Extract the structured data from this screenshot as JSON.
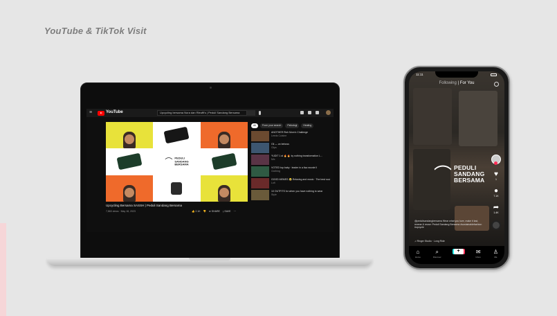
{
  "page": {
    "title": "YouTube & TikTok Visit"
  },
  "youtube": {
    "brand": "YouTube",
    "menu_icon": "hamburger-menu-icon",
    "search_text": "Upcycling bersama Nora dan Rieuffi's | Peduli Sandang Bersama",
    "logo_lines": [
      "PEDULI",
      "SANDANG",
      "BERSAMA"
    ],
    "video_title": "Upcycling Bersama SASSH | Peduli Sandang Bersama",
    "video_meta": "7,863 views · May 18, 2023",
    "actions": [
      "👍 2.1K",
      "👎",
      "➦ SHARE",
      "⤓ SAVE",
      "⋯"
    ],
    "chips": [
      "All",
      "From your search",
      "Psikologi",
      "Healing"
    ],
    "recommended": [
      {
        "title": "ANOTHER Rich Mom's Challenge",
        "channel": "Leeds Cuisine",
        "color": "#6b4a30"
      },
      {
        "title": "Gli — un beboss",
        "channel": "Clips",
        "color": "#3d5670"
      },
      {
        "title": "YUDIT 1 al 🔥 🔥 ky nothing transformation L...",
        "channel": "Mix",
        "color": "#5a3446"
      },
      {
        "title": "VOTED top baby · leader in a lisa rwonle Il",
        "channel": "Clothing",
        "color": "#2f5a43"
      },
      {
        "title": "GOOD MEMES 😂 Relaxing and music · The best soul minute",
        "channel": "Lofi",
        "color": "#6a2a2a"
      },
      {
        "title": "10 OUTFITS for when you have nothing to wear",
        "channel": "Style",
        "color": "#6a5a3a"
      }
    ]
  },
  "tiktok": {
    "status_time": "11:11",
    "tab_following": "Following",
    "tab_foryou": "For You",
    "logo_lines": [
      "PEDULI",
      "SANDANG",
      "BERSAMA"
    ],
    "likes": "1",
    "comments": "7.1K",
    "shares": "1.4K",
    "caption": "@pedulisandangbersama Wear what you love, make it last, rewear & reuse: Peduli Sandang Bersama #sustainablefashion #upcycle",
    "sound": "♫ Ringer Studio · Long Ride",
    "nav": [
      {
        "label": "Home",
        "icon": "home-icon",
        "glyph": "⌂"
      },
      {
        "label": "Discover",
        "icon": "search-icon",
        "glyph": "⌕"
      },
      {
        "label": "",
        "icon": "plus-icon",
        "glyph": "+"
      },
      {
        "label": "Inbox",
        "icon": "inbox-icon",
        "glyph": "✉"
      },
      {
        "label": "Me",
        "icon": "profile-icon",
        "glyph": "♙"
      }
    ]
  }
}
